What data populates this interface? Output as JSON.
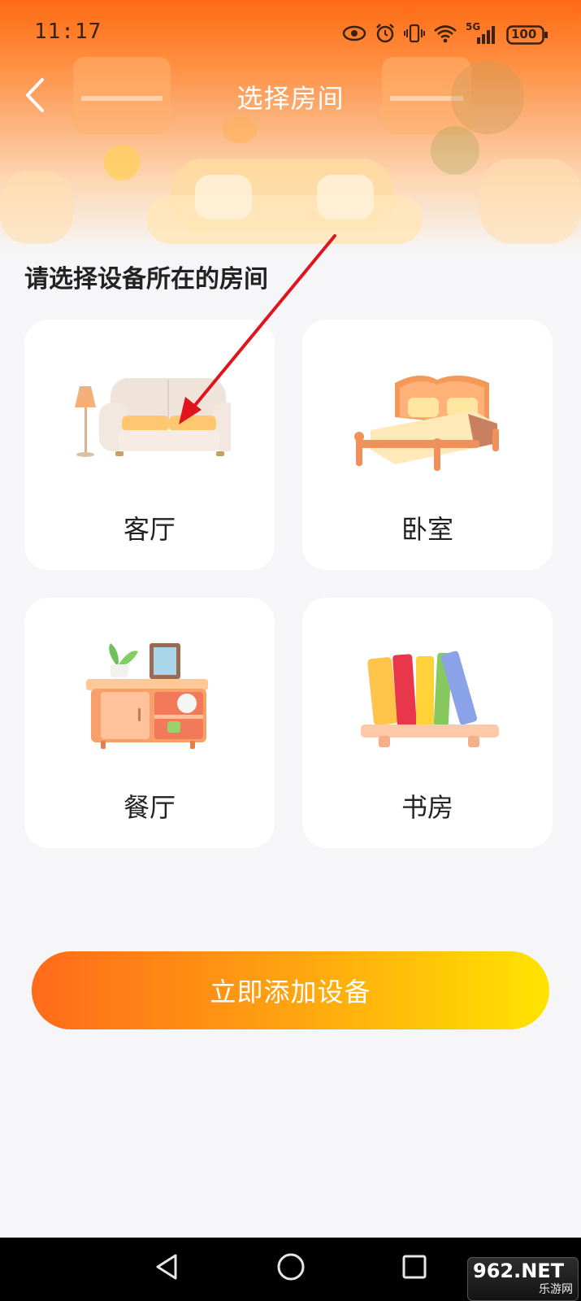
{
  "status_bar": {
    "time": "11:17",
    "network": "5G",
    "battery": "100",
    "icons": [
      "eye-icon",
      "alarm-icon",
      "vibrate-icon",
      "wifi-icon",
      "signal-icon",
      "battery-icon"
    ]
  },
  "header": {
    "title": "选择房间",
    "back_icon": "chevron-left-icon"
  },
  "section": {
    "prompt": "请选择设备所在的房间"
  },
  "rooms": [
    {
      "label": "客厅",
      "icon": "sofa-illustration"
    },
    {
      "label": "卧室",
      "icon": "bed-illustration"
    },
    {
      "label": "餐厅",
      "icon": "cabinet-illustration"
    },
    {
      "label": "书房",
      "icon": "bookshelf-illustration"
    }
  ],
  "action": {
    "add_label": "立即添加设备"
  },
  "watermark": {
    "main": "962.NET",
    "sub": "乐游网"
  },
  "colors": {
    "accent_start": "#ff6a1a",
    "accent_end": "#ffe400",
    "annotation_arrow": "#e0141c",
    "background": "#f6f6f8"
  }
}
